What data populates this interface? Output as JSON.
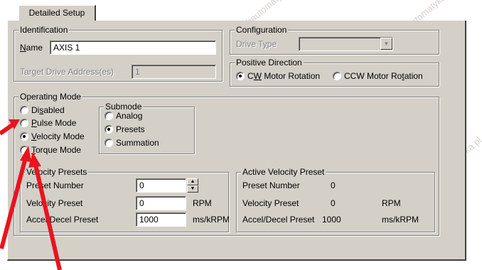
{
  "tab": {
    "label": "Detailed Setup"
  },
  "identification": {
    "title": "Identification",
    "name_label": "Name",
    "name_value": "AXIS 1",
    "target_label": "Target Drive Address(es)",
    "target_value": "1"
  },
  "configuration": {
    "title": "Configuration",
    "drive_type_label": "Drive Type",
    "drive_type_value": ""
  },
  "positive_direction": {
    "title": "Positive Direction",
    "cw": "CW Motor Rotation",
    "ccw": "CCW Motor Rotation",
    "selected": "cw"
  },
  "operating_mode": {
    "title": "Operating Mode",
    "options": [
      "Disabled",
      "Pulse Mode",
      "Velocity Mode",
      "Torque Mode"
    ],
    "selected": "Velocity Mode"
  },
  "submode": {
    "title": "Submode",
    "options": [
      "Analog",
      "Presets",
      "Summation"
    ],
    "selected": "Presets"
  },
  "velocity_presets": {
    "title": "Velocity Presets",
    "preset_number_label": "Preset Number",
    "preset_number_value": "0",
    "velocity_label": "Velocity Preset",
    "velocity_value": "0",
    "velocity_unit": "RPM",
    "accel_label": "Accel/Decel Preset",
    "accel_value": "1000",
    "accel_unit": "ms/kRPM"
  },
  "active_velocity_preset": {
    "title": "Active Velocity Preset",
    "preset_number_label": "Preset Number",
    "preset_number_value": "0",
    "velocity_label": "Velocity Preset",
    "velocity_value": "0",
    "velocity_unit": "RPM",
    "accel_label": "Accel/Decel Preset",
    "accel_value": "1000",
    "accel_unit": "ms/kRPM"
  },
  "watermark": "www.rgbautomatyka.pl",
  "colors": {
    "arrow": "#e8141e",
    "face": "#d4d0c8"
  }
}
